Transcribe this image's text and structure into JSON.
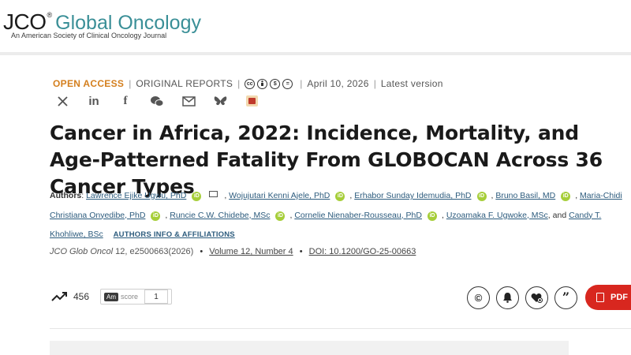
{
  "header": {
    "logo_main": "JCO",
    "logo_reg": "®",
    "logo_title": "Global Oncology",
    "logo_subtitle": "An American Society of Clinical Oncology Journal"
  },
  "meta": {
    "open_access": "OPEN ACCESS",
    "article_type": "ORIGINAL REPORTS",
    "license_icons": [
      "cc",
      "by",
      "nc",
      "nd"
    ],
    "date": "April 10, 2026",
    "version": "Latest version"
  },
  "share_icons": [
    "x-icon",
    "linkedin-icon",
    "facebook-icon",
    "wechat-icon",
    "email-icon",
    "bluesky-icon",
    "mendeley-icon"
  ],
  "article": {
    "title": "Cancer in Africa, 2022: Incidence, Mortality, and Age-Patterned Fatality From GLOBOCAN Across 36 Cancer Types"
  },
  "authors": {
    "label": "Authors",
    "list": [
      "Lawrence Ejike Ugwu, PhD",
      "Wojujutari Kenni Ajele, PhD",
      "Erhabor Sunday Idemudia, PhD",
      "Bruno Basil, MD",
      "Maria-Chidi Christiana Onyedibe, PhD",
      "Runcie C.W. Chidebe, MSc",
      "Cornelie Nienaber-Rousseau, PhD",
      "Uzoamaka F. Ugwoke, MSc",
      "Candy T. Khohliwe, BSc"
    ],
    "and": "and",
    "affiliations_link": "AUTHORS INFO & AFFILIATIONS"
  },
  "citation": {
    "journal": "JCO Glob Oncol",
    "volume_bold": "12",
    "pages": ", e2500663(2026)",
    "volume_link": "Volume 12, Number 4",
    "doi": "DOI: 10.1200/GO-25-00663"
  },
  "metrics": {
    "views": "456",
    "altmetric_badge": "Am",
    "altmetric_label": "score",
    "altmetric_count": "1"
  },
  "actions": {
    "pdf_label": "PDF"
  },
  "colors": {
    "accent_teal": "#3a8f97",
    "open_access_orange": "#d47f1e",
    "link_blue": "#2c5b7d",
    "pdf_red": "#d8271f",
    "orcid_green": "#a6ce39"
  }
}
